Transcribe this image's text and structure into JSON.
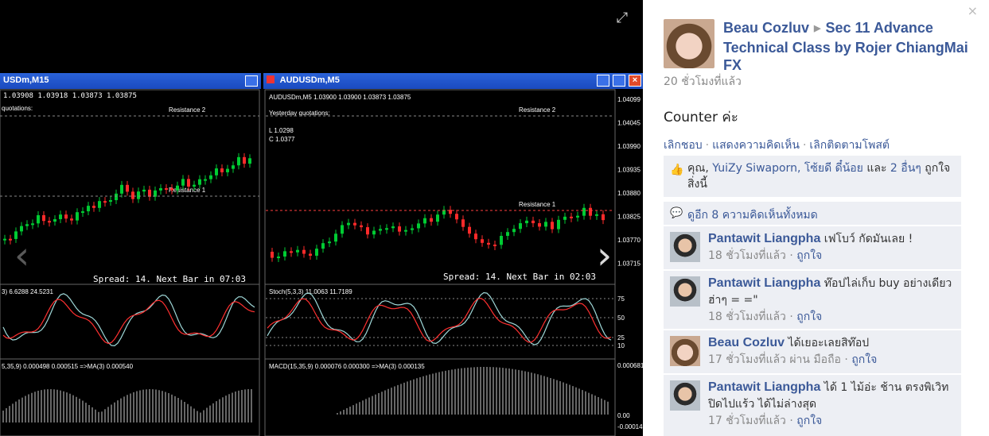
{
  "viewer": {
    "left_window": {
      "title": "USDm,M15",
      "info_line": "1.03908 1.03918 1.03873 1.03875",
      "quotes_label": "quotations:",
      "resistance_2": "Resistance 2",
      "resistance_1": "Resistance 1",
      "footer": "Spread: 14. Next Bar in 07:03",
      "stoch_label": "3) 6.6288 24.5231",
      "macd_label": "5,35,9) 0.000498 0.000515 =>MA(3) 0.000540"
    },
    "right_window": {
      "title": "AUDUSDm,M5",
      "info_line": "AUDUSDm,M5  1.03900 1.03900 1.03873 1.03875",
      "quotes_label": "Yesterday quotations:",
      "quote_lines": [
        "L 1.0298",
        "C 1.0377"
      ],
      "resistance_2": "Resistance 2",
      "resistance_1": "Resistance 1",
      "footer": "Spread: 14. Next Bar in 02:03",
      "price_axis": [
        "1.04099",
        "1.04045",
        "1.03990",
        "1.03935",
        "1.03880",
        "1.03825",
        "1.03770",
        "1.03715"
      ],
      "stoch_label": "Stoch(5,3,3) 11.0063 11.7189",
      "stoch_axis": [
        "75",
        "50",
        "25",
        "10"
      ],
      "macd_label": "MACD(15,35,9) 0.000076 0.000300 =>MA(3) 0.000135",
      "macd_axis": [
        "0.000681",
        "0.00",
        "-0.00014"
      ]
    }
  },
  "panel": {
    "author": "Beau Cozluv",
    "album": "Sec 11 Advance Technical Class by Rojer ChiangMai FX",
    "timestamp": "20 ชั่วโมงที่แล้ว",
    "caption": "Counter ค่ะ",
    "actions": [
      "เลิกชอบ",
      "แสดงความคิดเห็น",
      "เลิกติดตามโพสต์"
    ],
    "likes": {
      "you": "คุณ,",
      "person1": "YuiZy Siwaporn,",
      "person2": "โซ้ยดี ดี๋น้อย",
      "and_text": "และ",
      "others": "2 อื่นๆ",
      "suffix": "ถูกใจสิ่งนี้"
    },
    "view_all": "ดูอีก 8 ความคิดเห็นทั้งหมด",
    "comments": [
      {
        "name": "Pantawit Liangpha",
        "text": "เฟโบว์ กัดมันเลย !",
        "time": "18 ชั่วโมงที่แล้ว",
        "like": "ถูกใจ",
        "via": ""
      },
      {
        "name": "Pantawit Liangpha",
        "text": "ท๊อปไล่เก็บ buy อย่างเดียว ฮ่าๆ = =\"",
        "time": "18 ชั่วโมงที่แล้ว",
        "like": "ถูกใจ",
        "via": ""
      },
      {
        "name": "Beau Cozluv",
        "text": "ได้เยอะเลยสิท๊อป",
        "time": "17 ชั่วโมงที่แล้ว ผ่าน มือถือ",
        "like": "ถูกใจ",
        "via": ""
      },
      {
        "name": "Pantawit Liangpha",
        "text": "ได้ 1 ไม้อ่ะ ช้าน ตรงพิเวิท ปิดไปแร้ว ได้ไม่ล่างสุด",
        "time": "17 ชั่วโมงที่แล้ว",
        "like": "ถูกใจ",
        "via": ""
      }
    ]
  },
  "colors": {
    "link": "#3b5998",
    "panel_bg": "#edeff4",
    "bull": "#00cc33",
    "bear": "#ff2a2a"
  }
}
